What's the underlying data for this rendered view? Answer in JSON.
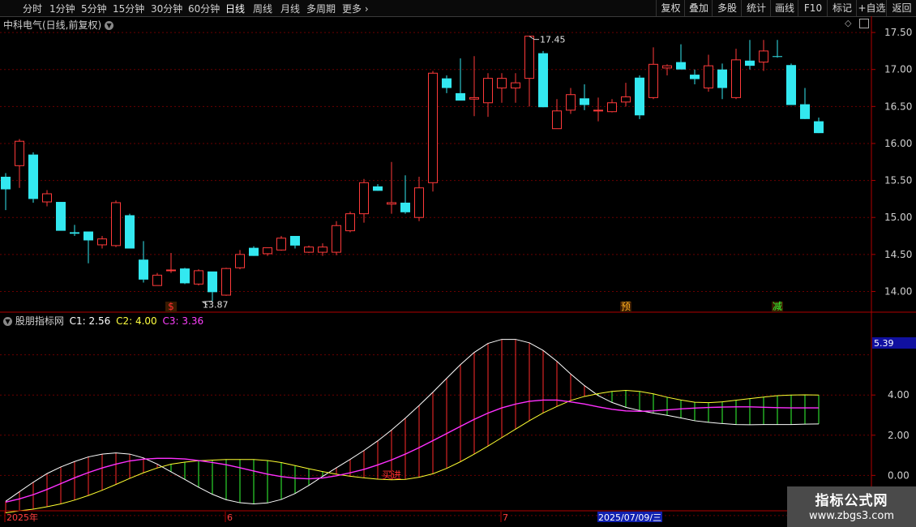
{
  "toolbar": {
    "tabs": [
      {
        "label": "分时",
        "active": false
      },
      {
        "label": "1分钟",
        "active": false
      },
      {
        "label": "5分钟",
        "active": false
      },
      {
        "label": "15分钟",
        "active": false
      },
      {
        "label": "30分钟",
        "active": false
      },
      {
        "label": "60分钟",
        "active": false
      },
      {
        "label": "日线",
        "active": true
      },
      {
        "label": "周线",
        "active": false
      },
      {
        "label": "月线",
        "active": false
      },
      {
        "label": "多周期",
        "active": false
      },
      {
        "label": "更多",
        "active": false
      }
    ],
    "right_buttons": [
      "复权",
      "叠加",
      "多股",
      "统计",
      "画线",
      "F10",
      "标记",
      "+自选",
      "返回"
    ]
  },
  "main_chart": {
    "title": "中科电气(日线,前复权)",
    "y_ticks": [
      "17.50",
      "17.00",
      "16.50",
      "16.00",
      "15.50",
      "15.00",
      "14.50",
      "14.00"
    ],
    "y_tick_values": [
      17.5,
      17.0,
      16.5,
      16.0,
      15.5,
      15.0,
      14.5,
      14.0
    ],
    "ylim": [
      13.72,
      17.72
    ],
    "high_label": "17.45",
    "low_label": "13.87",
    "signals": [
      {
        "text": "$",
        "color": "#ff3030",
        "bar": 12
      },
      {
        "text": "预",
        "color": "#ffb020",
        "bar": 45
      },
      {
        "text": "减",
        "color": "#33ff33",
        "bar": 56
      }
    ]
  },
  "chart_data": [
    {
      "type": "candlestick",
      "ylim": [
        13.72,
        17.72
      ],
      "colors": {
        "up": "#ff3a3a",
        "down": "#33e8f0"
      },
      "ohlc": [
        [
          15.55,
          15.6,
          15.1,
          15.38
        ],
        [
          15.7,
          16.06,
          15.4,
          16.03
        ],
        [
          15.85,
          15.88,
          15.2,
          15.25
        ],
        [
          15.21,
          15.37,
          15.15,
          15.32
        ],
        [
          15.21,
          15.21,
          14.82,
          14.82
        ],
        [
          14.8,
          14.9,
          14.75,
          14.78
        ],
        [
          14.81,
          14.81,
          14.38,
          14.69
        ],
        [
          14.63,
          14.75,
          14.58,
          14.71
        ],
        [
          14.62,
          15.23,
          14.6,
          15.2
        ],
        [
          15.03,
          15.05,
          14.58,
          14.58
        ],
        [
          14.43,
          14.68,
          14.12,
          14.16
        ],
        [
          14.08,
          14.25,
          14.08,
          14.22
        ],
        [
          14.28,
          14.52,
          14.25,
          14.29
        ],
        [
          14.31,
          14.32,
          14.1,
          14.11
        ],
        [
          14.1,
          14.3,
          14.08,
          14.28
        ],
        [
          14.27,
          14.27,
          13.87,
          13.99
        ],
        [
          13.95,
          14.32,
          13.94,
          14.31
        ],
        [
          14.32,
          14.56,
          14.3,
          14.5
        ],
        [
          14.59,
          14.61,
          14.49,
          14.48
        ],
        [
          14.51,
          14.56,
          14.48,
          14.59
        ],
        [
          14.56,
          14.75,
          14.55,
          14.72
        ],
        [
          14.75,
          14.75,
          14.58,
          14.62
        ],
        [
          14.53,
          14.62,
          14.52,
          14.6
        ],
        [
          14.53,
          14.65,
          14.48,
          14.6
        ],
        [
          14.53,
          14.95,
          14.49,
          14.89
        ],
        [
          14.82,
          15.08,
          14.8,
          15.05
        ],
        [
          15.05,
          15.52,
          14.93,
          15.47
        ],
        [
          15.42,
          15.45,
          15.37,
          15.36
        ],
        [
          15.18,
          15.75,
          15.05,
          15.2
        ],
        [
          15.2,
          15.57,
          15.05,
          15.07
        ],
        [
          15.0,
          15.55,
          14.95,
          15.4
        ],
        [
          15.47,
          16.98,
          15.35,
          16.95
        ],
        [
          16.88,
          16.92,
          16.68,
          16.75
        ],
        [
          16.68,
          17.15,
          16.6,
          16.58
        ],
        [
          16.6,
          17.18,
          16.37,
          16.62
        ],
        [
          16.55,
          16.95,
          16.36,
          16.88
        ],
        [
          16.75,
          16.95,
          16.55,
          16.88
        ],
        [
          16.75,
          16.95,
          16.55,
          16.82
        ],
        [
          16.88,
          17.45,
          16.5,
          17.45
        ],
        [
          17.22,
          17.25,
          16.5,
          16.49
        ],
        [
          16.2,
          16.6,
          16.2,
          16.44
        ],
        [
          16.45,
          16.75,
          16.4,
          16.66
        ],
        [
          16.61,
          16.8,
          16.45,
          16.52
        ],
        [
          16.45,
          16.62,
          16.3,
          16.45
        ],
        [
          16.43,
          16.6,
          16.42,
          16.55
        ],
        [
          16.56,
          16.82,
          16.5,
          16.63
        ],
        [
          16.89,
          16.92,
          16.33,
          16.38
        ],
        [
          16.62,
          17.3,
          16.6,
          17.07
        ],
        [
          17.02,
          17.07,
          16.92,
          17.05
        ],
        [
          17.1,
          17.34,
          17.0,
          17.0
        ],
        [
          16.93,
          17.0,
          16.8,
          16.87
        ],
        [
          16.75,
          17.2,
          16.7,
          17.05
        ],
        [
          17.0,
          17.08,
          16.6,
          16.75
        ],
        [
          16.62,
          17.28,
          16.6,
          17.13
        ],
        [
          17.12,
          17.4,
          17.0,
          17.05
        ],
        [
          17.1,
          17.4,
          16.98,
          17.25
        ],
        [
          17.18,
          17.4,
          17.16,
          17.17
        ],
        [
          17.06,
          17.08,
          16.53,
          16.52
        ],
        [
          16.53,
          16.75,
          16.35,
          16.33
        ],
        [
          16.3,
          16.35,
          16.15,
          16.14
        ]
      ]
    },
    {
      "type": "line",
      "ylim": [
        -1.6,
        7.6
      ],
      "title": "股朋指标网",
      "series": [
        {
          "name": "C1",
          "values": [
            -1.29,
            -0.81,
            -0.34,
            0.09,
            0.42,
            0.69,
            0.92,
            1.06,
            1.12,
            1.06,
            0.87,
            0.56,
            0.18,
            -0.2,
            -0.59,
            -0.94,
            -1.21,
            -1.36,
            -1.42,
            -1.37,
            -1.2,
            -0.9,
            -0.5,
            -0.05,
            0.38,
            0.8,
            1.24,
            1.72,
            2.26,
            2.85,
            3.48,
            4.14,
            4.83,
            5.51,
            6.12,
            6.57,
            6.77,
            6.77,
            6.6,
            6.22,
            5.68,
            5.05,
            4.47,
            3.97,
            3.63,
            3.39,
            3.23,
            3.1,
            2.99,
            2.86,
            2.72,
            2.64,
            2.58,
            2.53,
            2.52,
            2.53,
            2.53,
            2.53,
            2.55,
            2.56
          ]
        },
        {
          "name": "C2",
          "values": [
            -1.86,
            -1.76,
            -1.68,
            -1.56,
            -1.42,
            -1.23,
            -1.0,
            -0.74,
            -0.45,
            -0.15,
            0.13,
            0.37,
            0.56,
            0.66,
            0.73,
            0.76,
            0.79,
            0.79,
            0.79,
            0.74,
            0.64,
            0.49,
            0.33,
            0.19,
            0.06,
            -0.04,
            -0.12,
            -0.19,
            -0.22,
            -0.2,
            -0.09,
            0.08,
            0.35,
            0.68,
            1.06,
            1.46,
            1.88,
            2.3,
            2.72,
            3.11,
            3.43,
            3.73,
            3.93,
            4.07,
            4.18,
            4.23,
            4.18,
            4.06,
            3.89,
            3.75,
            3.64,
            3.62,
            3.66,
            3.74,
            3.82,
            3.9,
            3.97,
            4.0,
            4.01,
            4.0
          ]
        },
        {
          "name": "C3",
          "values": [
            -1.33,
            -1.17,
            -0.96,
            -0.7,
            -0.41,
            -0.12,
            0.14,
            0.37,
            0.56,
            0.72,
            0.81,
            0.85,
            0.85,
            0.82,
            0.74,
            0.64,
            0.53,
            0.38,
            0.22,
            0.06,
            -0.06,
            -0.14,
            -0.17,
            -0.13,
            -0.02,
            0.13,
            0.3,
            0.52,
            0.77,
            1.06,
            1.38,
            1.73,
            2.08,
            2.44,
            2.79,
            3.1,
            3.36,
            3.55,
            3.69,
            3.75,
            3.75,
            3.66,
            3.55,
            3.41,
            3.29,
            3.21,
            3.19,
            3.21,
            3.26,
            3.31,
            3.35,
            3.38,
            3.4,
            3.41,
            3.41,
            3.39,
            3.37,
            3.36,
            3.36,
            3.36
          ]
        }
      ]
    }
  ],
  "indicator": {
    "name": "股朋指标网",
    "c1_label": "C1: 2.56",
    "c2_label": "C2: 4.00",
    "c3_label": "C3: 3.36",
    "y_ticks": [
      "4.00",
      "2.00",
      "0.00"
    ],
    "y_tick_values": [
      4.0,
      2.0,
      0.0
    ],
    "current_value": "5.39",
    "annotation": "买进",
    "annotation_bar": 28
  },
  "date_axis": {
    "labels": [
      {
        "text": "2025年",
        "bar": 0
      },
      {
        "text": "6",
        "bar": 16
      },
      {
        "text": "7",
        "bar": 36
      }
    ],
    "cursor_date": "2025/07/09/三",
    "cursor_bar": 44
  },
  "watermark": {
    "line1": "指标公式网",
    "line2": "www.zbgs3.com"
  }
}
